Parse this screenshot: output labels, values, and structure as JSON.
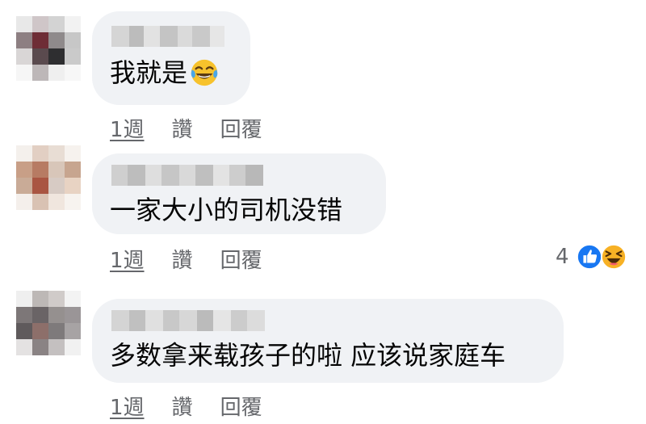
{
  "comments": [
    {
      "text": "我就是",
      "emoji": "laughing-tears-emoji",
      "time": "1週",
      "like": "讚",
      "reply": "回覆"
    },
    {
      "text": "一家大小的司机没错",
      "time": "1週",
      "like": "讚",
      "reply": "回覆",
      "reaction_count": "4",
      "reaction_icons": [
        "like-reaction-icon",
        "haha-reaction-icon"
      ]
    },
    {
      "text": "多数拿来载孩子的啦 应该说家庭车",
      "time": "1週",
      "like": "讚",
      "reply": "回覆"
    }
  ],
  "colors": {
    "bubble": "#f0f2f5",
    "text": "#050505",
    "meta": "#65676b",
    "like_blue": "#1877f2",
    "haha_yellow": "#f7b125"
  }
}
